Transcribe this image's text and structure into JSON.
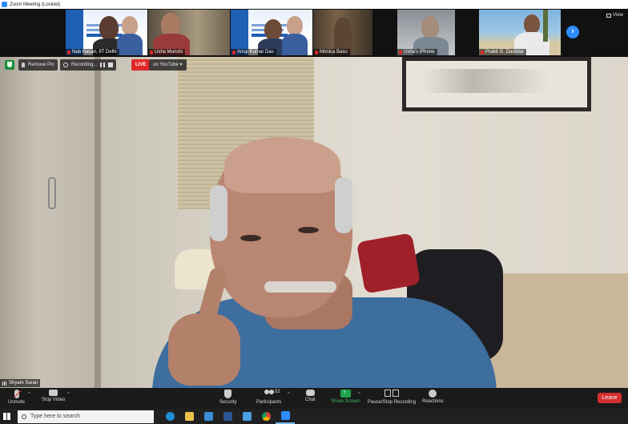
{
  "window": {
    "title": "Zoom Meeting (Locked)"
  },
  "gallery": {
    "view_label": "View",
    "participants": [
      {
        "name": "Nab Hasan, IIT Delhi",
        "kind": "slide"
      },
      {
        "name": "Usha Munshi",
        "kind": "camera"
      },
      {
        "name": "Anup Kumar Das",
        "kind": "slide"
      },
      {
        "name": "Monica Basu",
        "kind": "camera"
      },
      {
        "name": "Usha's iPhone",
        "kind": "camera"
      },
      {
        "name": "Prabir G. Dastidar",
        "kind": "camera"
      }
    ]
  },
  "main_video": {
    "remove_pin_label": "Remove Pin",
    "recording_label": "Recording...",
    "live_label": "LIVE",
    "stream_label": "on YouTube ▾",
    "speaker_name": "Shyam Saran"
  },
  "toolbar": {
    "unmute": "Unmute",
    "stop_video": "Stop Video",
    "security": "Security",
    "participants": "Participants",
    "participants_count": "52",
    "chat": "Chat",
    "share_screen": "Share Screen",
    "pause_stop_recording": "Pause/Stop Recording",
    "reactions": "Reactions",
    "leave": "Leave"
  },
  "taskbar": {
    "search_placeholder": "Type here to search",
    "apps": [
      "edge-icon",
      "file-explorer-icon",
      "mail-icon",
      "word-icon",
      "photos-icon",
      "chrome-icon",
      "zoom-icon"
    ]
  },
  "colors": {
    "accent": "#2d8cff",
    "live": "#e02828",
    "leave": "#d32f2f",
    "share": "#1fa34a"
  }
}
